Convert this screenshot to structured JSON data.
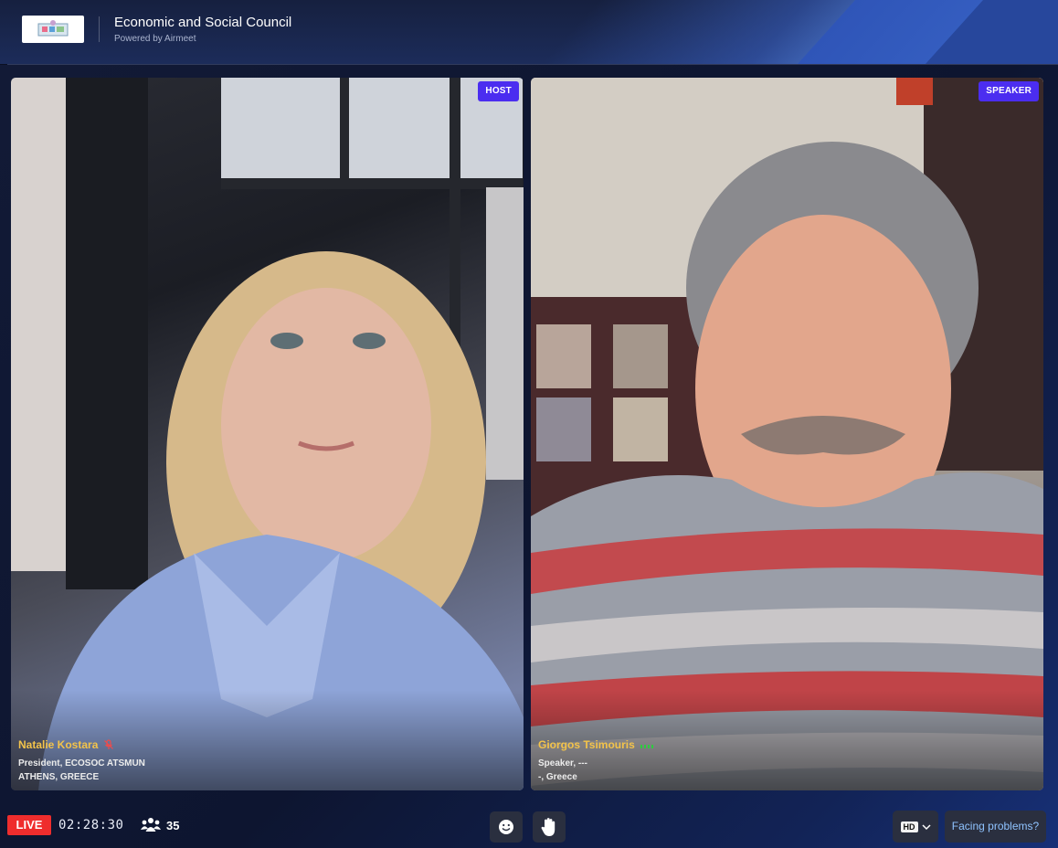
{
  "header": {
    "title": "Economic and Social Council",
    "powered_by": "Powered by Airmeet"
  },
  "participants": [
    {
      "name": "Natalie Kostara",
      "role_badge": "HOST",
      "title": "President, ECOSOC ATSMUN",
      "location": "ATHENS, GREECE",
      "mic": "muted-mic-icon"
    },
    {
      "name": "Giorgos Tsimouris",
      "role_badge": "SPEAKER",
      "title": "Speaker, ---",
      "location": "-, Greece",
      "mic": "audio-level-icon"
    }
  ],
  "bottom_bar": {
    "live_label": "LIVE",
    "elapsed": "02:28:30",
    "attendee_count": "35",
    "quality_label": "HD",
    "help_label": "Facing problems?"
  },
  "colors": {
    "badge": "#4b2df0",
    "live": "#ef2d2d",
    "name": "#f3c34a",
    "help_link": "#8fc3ff"
  }
}
